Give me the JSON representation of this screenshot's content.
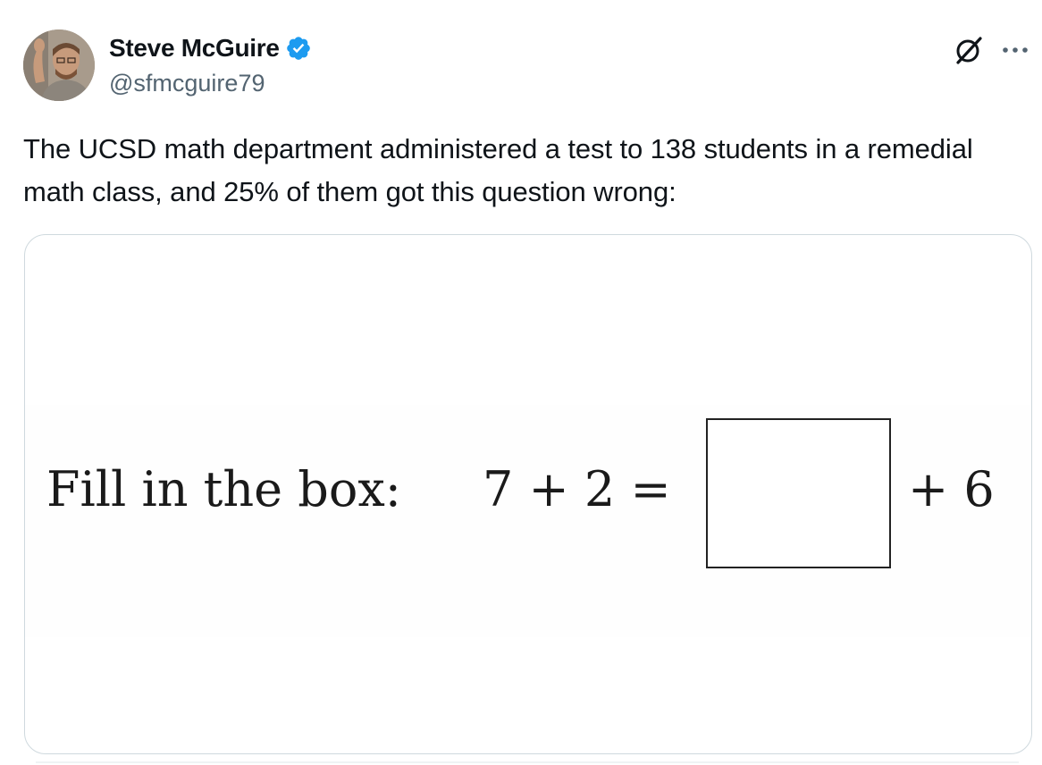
{
  "tweet": {
    "author": {
      "display_name": "Steve McGuire",
      "handle": "@sfmcguire79",
      "verified": true,
      "verified_badge_color": "#1d9bf0"
    },
    "header_icons": [
      "grok-icon",
      "more-options-icon"
    ],
    "text": "The UCSD math department administered a test to 138 students in a remedial math class, and 25% of them got this question wrong:",
    "media": {
      "question_label": "Fill in the box:",
      "equation_left": "7 + 2 =",
      "equation_right": "+ 6"
    }
  },
  "colors": {
    "text_primary": "#0f1419",
    "text_secondary": "#536471",
    "border": "#cfd9de",
    "accent": "#1d9bf0"
  }
}
